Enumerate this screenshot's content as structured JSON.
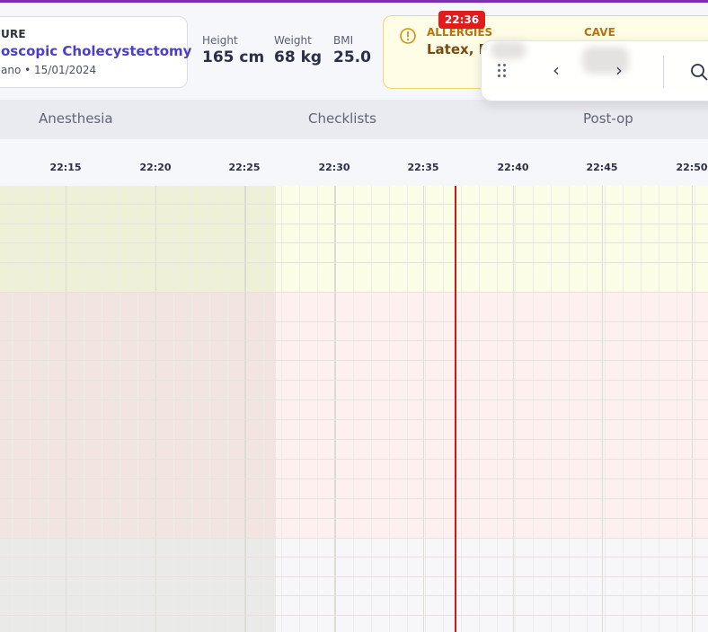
{
  "procedure": {
    "label": "URE",
    "title": "oscopic Cholecystectomy",
    "meta": "ano • 15/01/2024"
  },
  "vitals": [
    {
      "label": "Height",
      "value": "165 cm"
    },
    {
      "label": "Weight",
      "value": "68 kg"
    },
    {
      "label": "BMI",
      "value": "25.0"
    }
  ],
  "allergies": {
    "label": "ALLERGIES",
    "value": "Latex, P",
    "cave_label": "CAVE",
    "icon": "warning-circle-icon"
  },
  "current_time": "22:36",
  "toolbar": {
    "prev_label": "‹",
    "next_label": "›",
    "drag_icon": "drag-handle-icon",
    "search_icon": "search-icon"
  },
  "tabs": [
    {
      "label": "Anesthesia"
    },
    {
      "label": "Checklists"
    },
    {
      "label": "Post-op"
    }
  ],
  "time_ticks": [
    "22:15",
    "22:20",
    "22:25",
    "22:30",
    "22:35",
    "22:40",
    "22:45",
    "22:50"
  ],
  "colors": {
    "accent": "#7a2fb0",
    "procedure_title": "#4b3fc4",
    "now_line": "#d21515",
    "allergy_bg": "#fffde6",
    "band_yellow": "#fbfde6",
    "band_pink": "#fff0f0",
    "band_gray": "#f7f7f9"
  }
}
